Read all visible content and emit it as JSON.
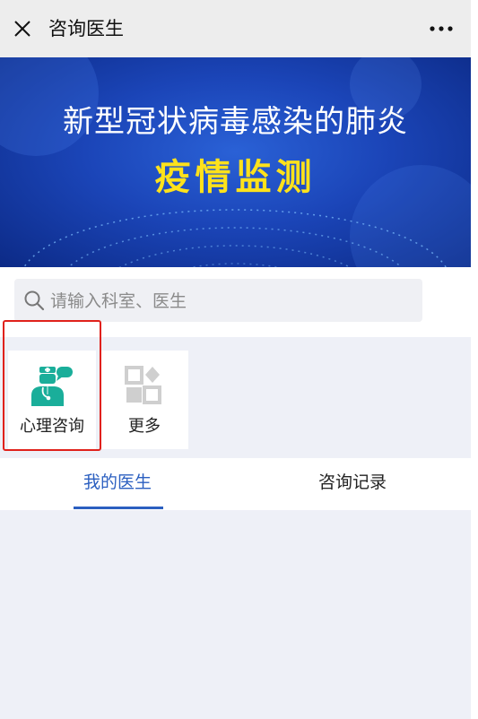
{
  "titlebar": {
    "title": "咨询医生",
    "close_icon": "close-icon",
    "more_icon": "more-icon"
  },
  "banner": {
    "title": "新型冠状病毒感染的肺炎",
    "subtitle": "疫情监测"
  },
  "search": {
    "placeholder": "请输入科室、医生",
    "value": ""
  },
  "services": [
    {
      "label": "心理咨询",
      "icon": "doctor-icon"
    },
    {
      "label": "更多",
      "icon": "more-apps-icon"
    }
  ],
  "tabs": [
    {
      "label": "我的医生"
    },
    {
      "label": "咨询记录"
    }
  ],
  "colors": {
    "accent": "#2b5fc0",
    "banner_text": "#ffe21b",
    "highlight": "#e0211b",
    "icon_green": "#1aae9a"
  }
}
